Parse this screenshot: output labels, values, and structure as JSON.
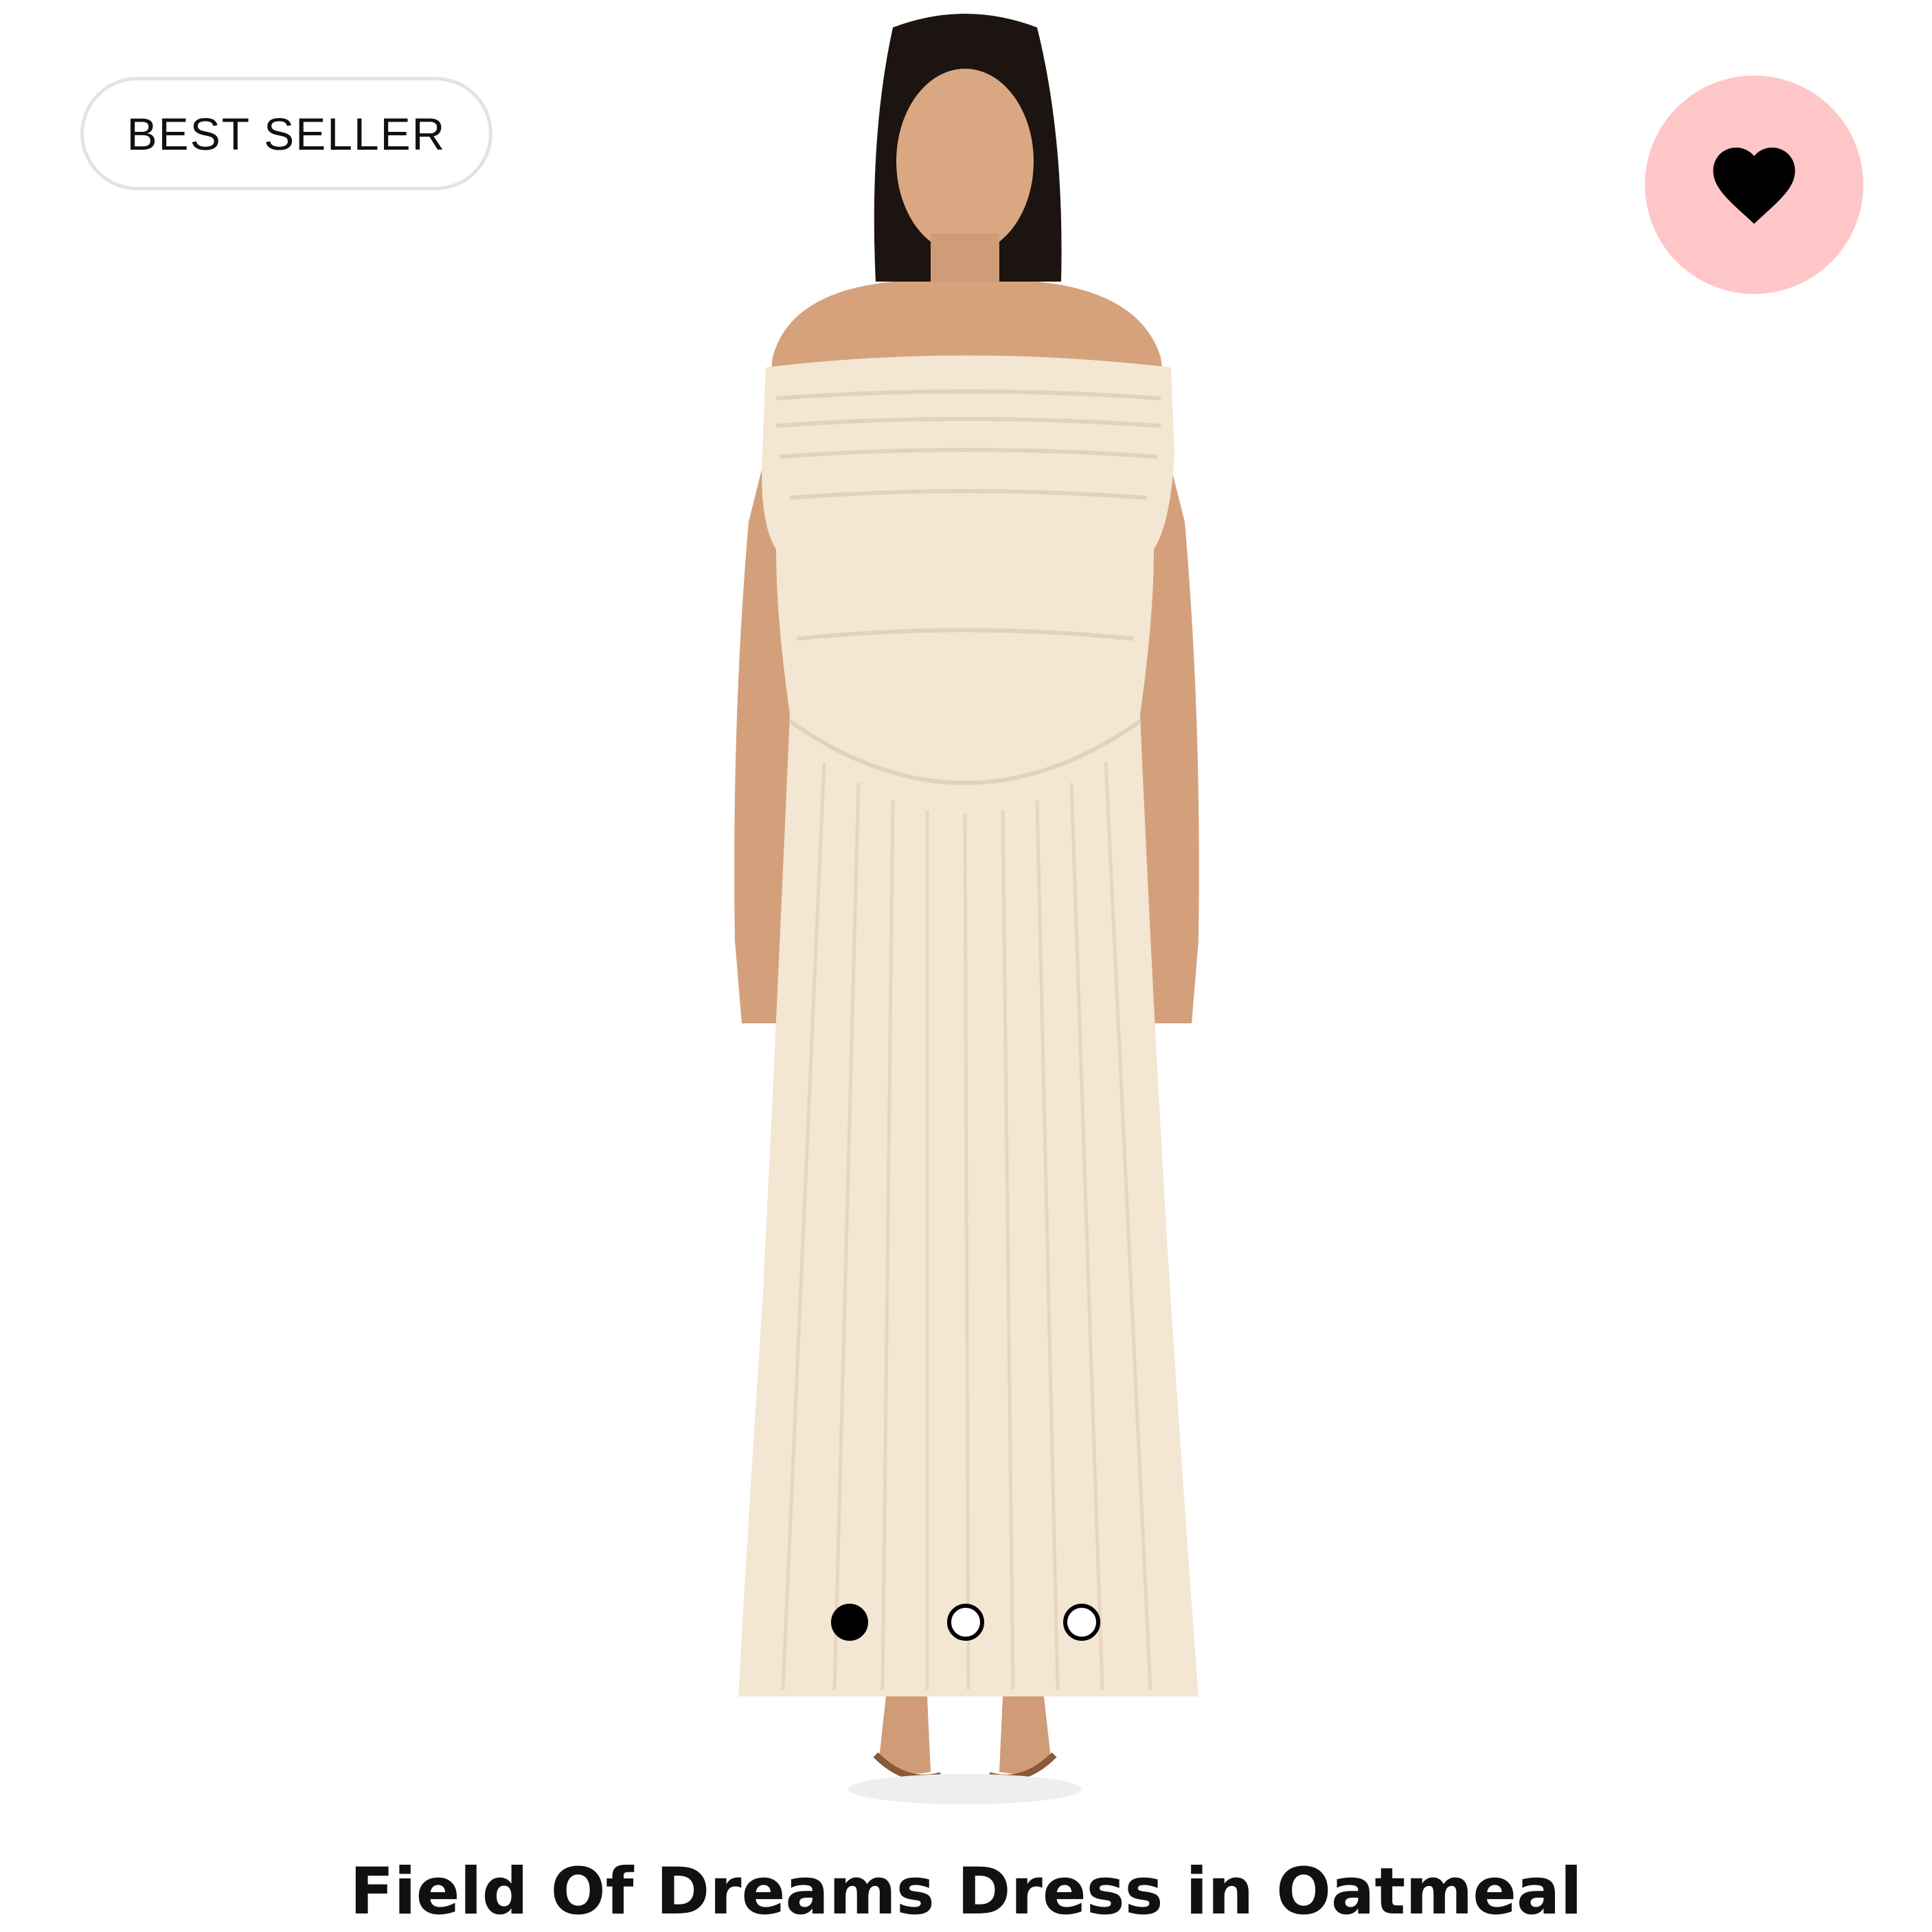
{
  "badge": {
    "label": "BEST SELLER"
  },
  "favorite": {
    "icon": "heart-icon",
    "background": "#ffc6c8",
    "active": true
  },
  "carousel": {
    "total_images": 3,
    "current_image": 1
  },
  "product": {
    "title": "Field Of Dreams Dress in Oatmeal"
  },
  "colors": {
    "dress": "#f3e6d3",
    "skin": "#d6a27c",
    "hair": "#1b1410"
  }
}
